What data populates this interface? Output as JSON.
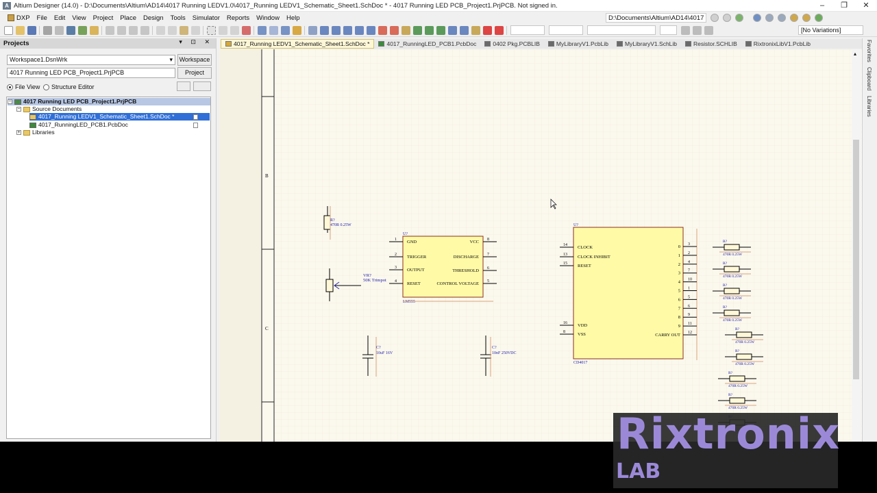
{
  "app": {
    "title": "Altium Designer (14.0) - D:\\Documents\\Altium\\AD14\\4017 Running LEDV1.0\\4017_Running LEDV1_Schematic_Sheet1.SchDoc * - 4017 Running LED PCB_Project1.PrjPCB. Not signed in.",
    "logo": "A"
  },
  "menu": [
    "DXP",
    "File",
    "Edit",
    "View",
    "Project",
    "Place",
    "Design",
    "Tools",
    "Simulator",
    "Reports",
    "Window",
    "Help"
  ],
  "path_box": "D:\\Documents\\Altium\\AD14\\4017",
  "variations": "[No Variations]",
  "projects_panel": {
    "title": "Projects",
    "workspace_field": "Workspace1.DsnWrk",
    "workspace_button": "Workspace",
    "project_field": "4017 Running LED PCB_Project1.PrjPCB",
    "project_button": "Project",
    "file_view": "File View",
    "structure_editor": "Structure Editor",
    "tree": {
      "project": "4017 Running LED PCB_Project1.PrjPCB",
      "source_documents": "Source Documents",
      "sch_doc": "4017_Running LEDV1_Schematic_Sheet1.SchDoc *",
      "pcb_doc": "4017_RunningLED_PCB1.PcbDoc",
      "libraries": "Libraries"
    }
  },
  "tabs": [
    {
      "label": "4017_Running LEDV1_Schematic_Sheet1.SchDoc *",
      "color": "#d6a83a"
    },
    {
      "label": "4017_RunningLED_PCB1.PcbDoc",
      "color": "#3c8a3c"
    },
    {
      "label": "0402 Pkg.PCBLIB",
      "color": "#6a6a6a"
    },
    {
      "label": "MyLibraryV1.PcbLib",
      "color": "#6a6a6a"
    },
    {
      "label": "MyLibraryV1.SchLib",
      "color": "#6a6a6a"
    },
    {
      "label": "Resistor.SCHLIB",
      "color": "#6a6a6a"
    },
    {
      "label": "RixtronixLibV1.PcbLib",
      "color": "#6a6a6a"
    }
  ],
  "right_panel": [
    "Favorites",
    "Clipboard",
    "Libraries"
  ],
  "schematic": {
    "zone_b": "B",
    "zone_c": "C",
    "r_designator": "R?",
    "r_value": "470R 0.25W",
    "vr_designator": "VR?",
    "vr_value": "50K Trimpot",
    "c1_designator": "C?",
    "c1_value": "10uF 16V",
    "c2_designator": "C?",
    "c2_value": "10nF 250VDC",
    "u1": {
      "designator": "U?",
      "part": "LM555",
      "left_pins": [
        {
          "num": "1",
          "name": "GND"
        },
        {
          "num": "2",
          "name": "TRIGGER"
        },
        {
          "num": "3",
          "name": "OUTPUT"
        },
        {
          "num": "4",
          "name": "RESET"
        }
      ],
      "right_pins": [
        {
          "num": "8",
          "name": "VCC"
        },
        {
          "num": "7",
          "name": "DISCHARGE"
        },
        {
          "num": "6",
          "name": "THRESHOLD"
        },
        {
          "num": "5",
          "name": "CONTROL VOLTAGE"
        }
      ]
    },
    "u2": {
      "designator": "U?",
      "part": "CD4017",
      "left_pins": [
        {
          "num": "14",
          "name": "CLOCK"
        },
        {
          "num": "13",
          "name": "CLOCK INHIBIT"
        },
        {
          "num": "15",
          "name": "RESET"
        },
        {
          "num": "16",
          "name": "VDD"
        },
        {
          "num": "8",
          "name": "VSS"
        }
      ],
      "right_pins": [
        {
          "num": "3",
          "name": "0"
        },
        {
          "num": "2",
          "name": "1"
        },
        {
          "num": "4",
          "name": "2"
        },
        {
          "num": "7",
          "name": "3"
        },
        {
          "num": "10",
          "name": "4"
        },
        {
          "num": "1",
          "name": "5"
        },
        {
          "num": "5",
          "name": "6"
        },
        {
          "num": "6",
          "name": "7"
        },
        {
          "num": "9",
          "name": "8"
        },
        {
          "num": "11",
          "name": "9"
        },
        {
          "num": "12",
          "name": "CARRY OUT"
        }
      ]
    },
    "resistor_array_count_label": "R?"
  },
  "watermark": {
    "brand": "Rixtronix",
    "sub": "LAB"
  }
}
